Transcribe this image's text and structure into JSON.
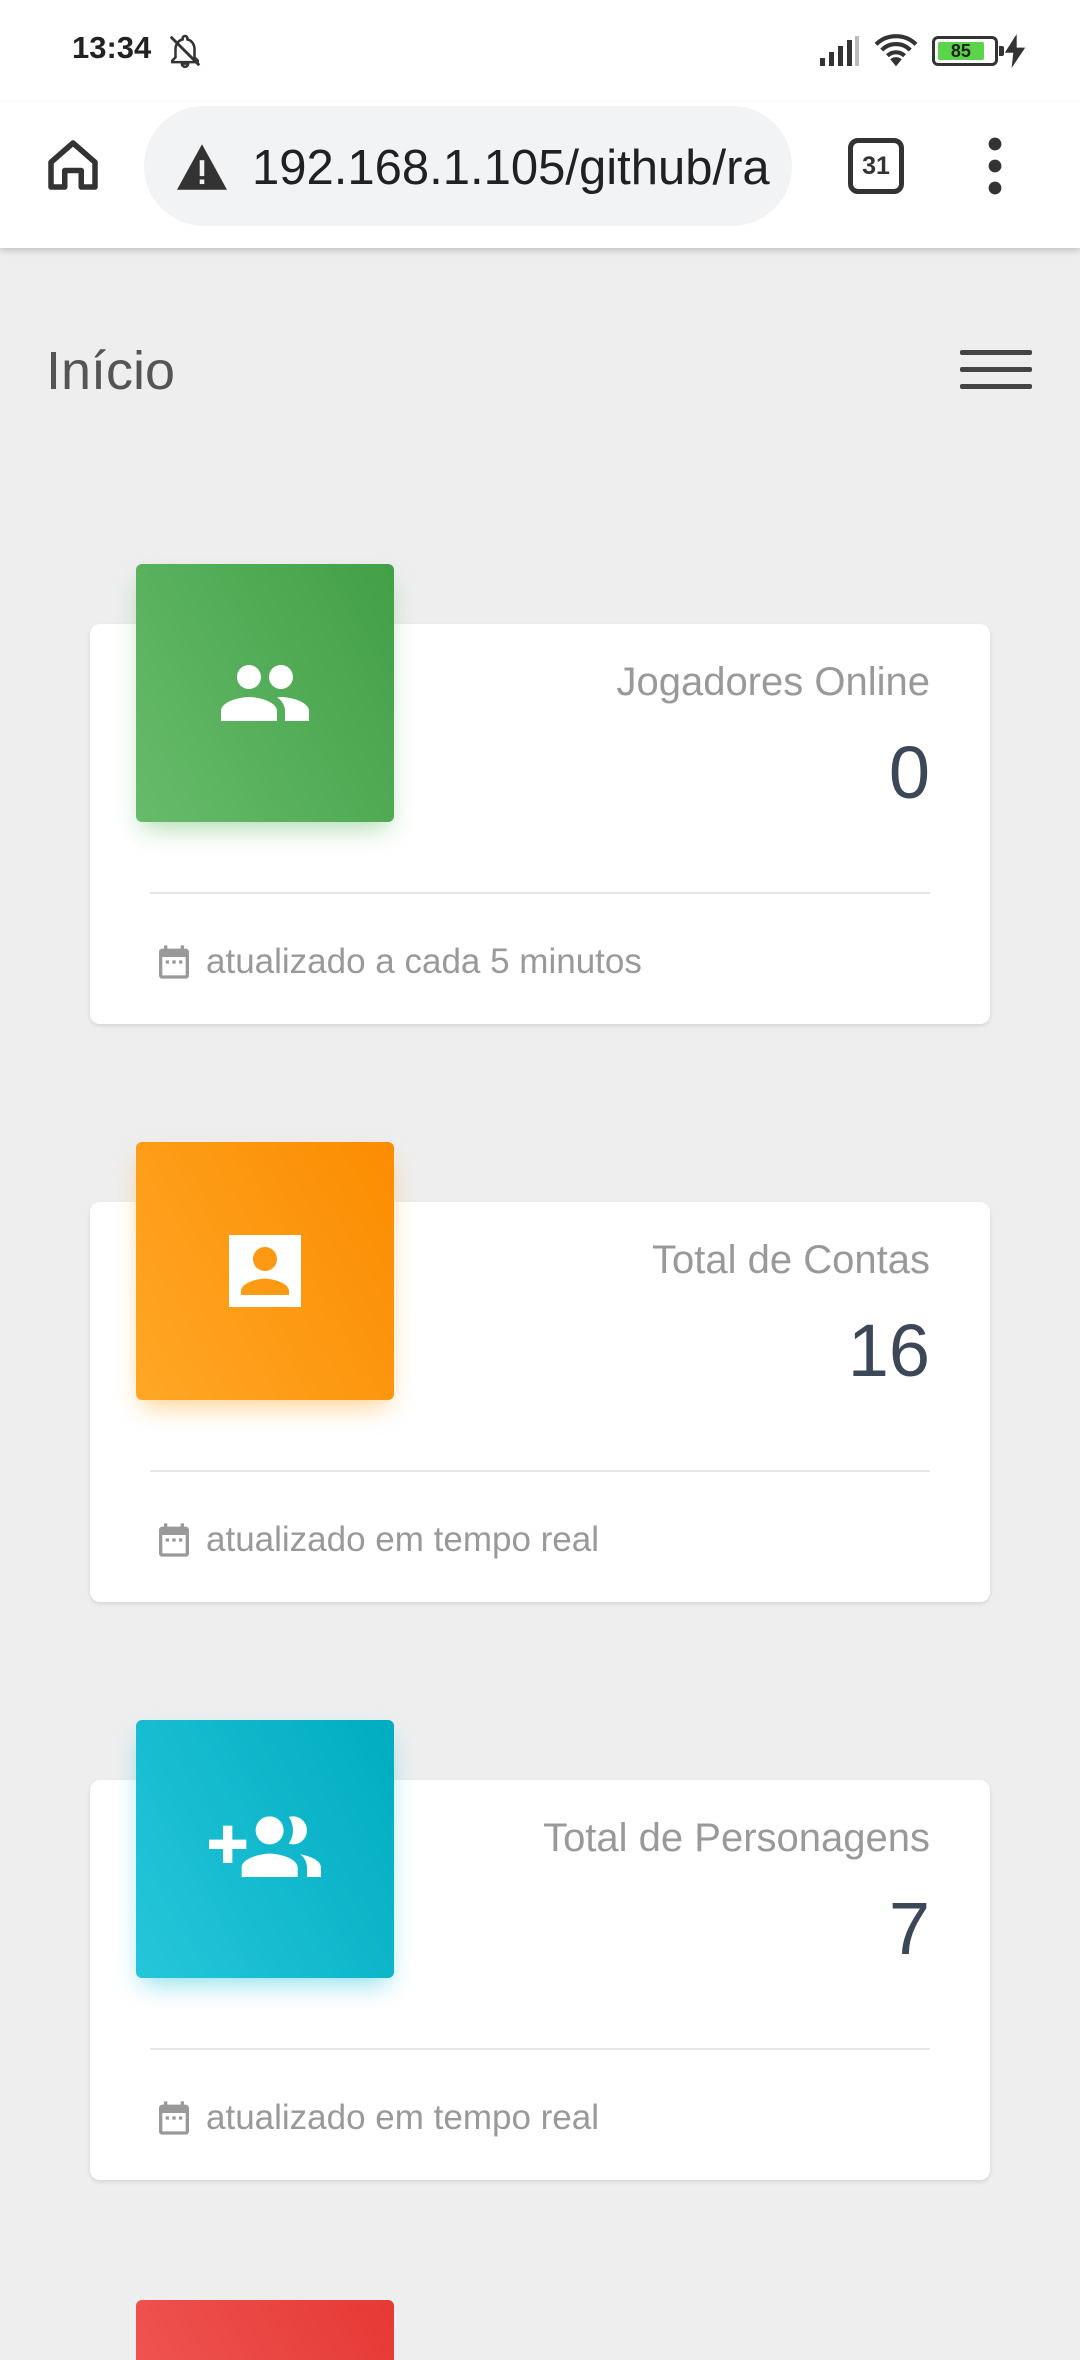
{
  "status_bar": {
    "time": "13:34",
    "battery": "85"
  },
  "browser": {
    "url": "192.168.1.105/github/ra",
    "tab_count": "31"
  },
  "page": {
    "title": "Início"
  },
  "cards": [
    {
      "label": "Jogadores Online",
      "value": "0",
      "footer": "atualizado a cada 5 minutos",
      "color": "#4caf50",
      "icon": "group-icon"
    },
    {
      "label": "Total de Contas",
      "value": "16",
      "footer": "atualizado em tempo real",
      "color": "#ff9800",
      "icon": "contact-icon"
    },
    {
      "label": "Total de Personagens",
      "value": "7",
      "footer": "atualizado em tempo real",
      "color": "#00bcd4",
      "icon": "group-add-icon"
    }
  ],
  "partial_card_color": "#e53935"
}
